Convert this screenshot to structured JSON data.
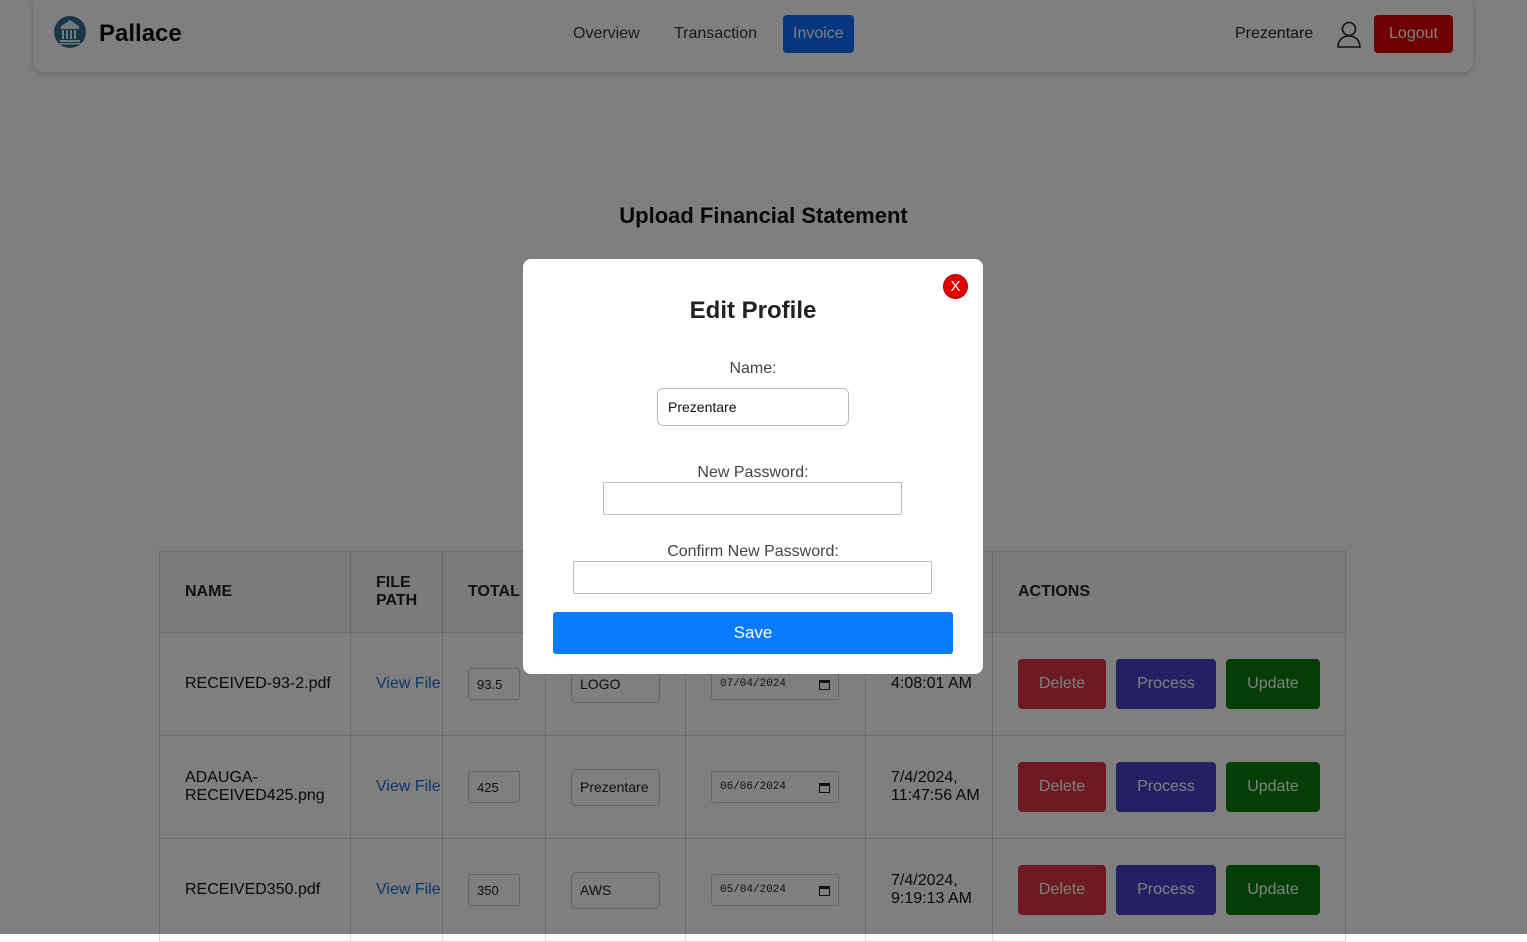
{
  "navbar": {
    "brand": "Pallace",
    "links": [
      "Overview",
      "Transaction",
      "Invoice"
    ],
    "active_link": "Invoice",
    "user_name": "Prezentare",
    "logout_label": "Logout"
  },
  "page": {
    "title": "Upload Financial Statement"
  },
  "table": {
    "headers": [
      "NAME",
      "FILE PATH",
      "TOTAL",
      "",
      "",
      "",
      "ACTIONS"
    ],
    "rows": [
      {
        "name": "RECEIVED-93-2.pdf",
        "file_link": "View File",
        "total": "93.5",
        "vendor": "LOGO",
        "date": "07/04/2024",
        "uploaded": "4:08:01 AM"
      },
      {
        "name": "ADAUGA-RECEIVED425.png",
        "file_link": "View File",
        "total": "425",
        "vendor": "Prezentare",
        "date": "06/06/2024",
        "uploaded": "7/4/2024, 11:47:56 AM"
      },
      {
        "name": "RECEIVED350.pdf",
        "file_link": "View File",
        "total": "350",
        "vendor": "AWS",
        "date": "05/04/2024",
        "uploaded": "7/4/2024, 9:19:13 AM"
      }
    ],
    "actions": {
      "delete": "Delete",
      "process": "Process",
      "update": "Update"
    }
  },
  "modal": {
    "close_label": "X",
    "title": "Edit Profile",
    "name_label": "Name:",
    "name_value": "Prezentare",
    "new_password_label": "New Password:",
    "new_password_value": "",
    "confirm_password_label": "Confirm New Password:",
    "confirm_password_value": "",
    "save_label": "Save"
  },
  "colors": {
    "primary": "#0d6efd",
    "logout": "#dc0000",
    "delete": "#dc3545",
    "process": "#4a3fc9",
    "update": "#0a7d0a",
    "close": "#e30000",
    "save": "#0a7bff"
  },
  "icons": {
    "logo": "bank-building-icon",
    "user": "user-profile-icon",
    "date": "calendar-icon"
  }
}
